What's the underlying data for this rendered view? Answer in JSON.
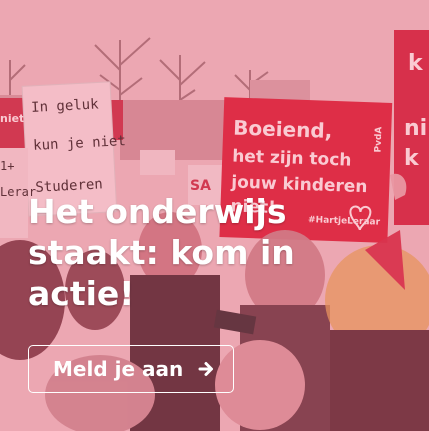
{
  "banner": {
    "headline": "Het onderwijs staakt: kom in actie!",
    "cta_label": "Meld je aan",
    "cta_icon": "arrow-right-icon",
    "tint_color": "#ec405f",
    "text_color": "#ffffff"
  },
  "photo_signs": {
    "main_sign": {
      "lines": [
        "Boeiend,",
        "het zijn toch",
        "jouw kinderen",
        "niet!"
      ],
      "hashtag": "#HartjeLeraar",
      "party": "PvdA",
      "color": "#d8283f"
    },
    "hand_sign": {
      "lines": [
        "In geluk",
        "kun je niet",
        "Studeren"
      ]
    },
    "right_sign": {
      "lines": [
        "k",
        "ni",
        "k"
      ]
    },
    "left_sign": {
      "lines": [
        "niet",
        "Lerar",
        "1+"
      ]
    },
    "small_sign": {
      "text": "SA"
    }
  }
}
